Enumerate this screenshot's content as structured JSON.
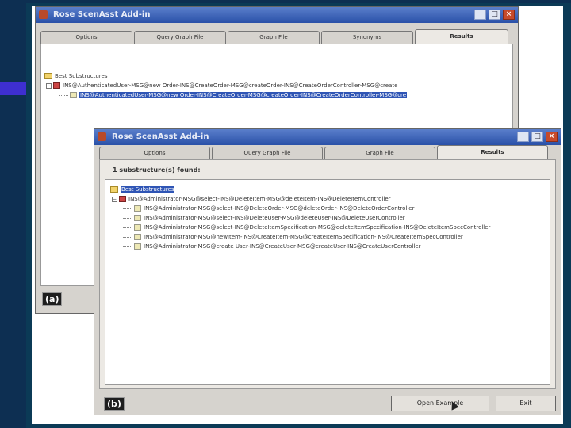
{
  "window_a": {
    "title": "Rose ScenAsst Add-in",
    "tabs": [
      "Options",
      "Query Graph File",
      "Graph File",
      "Synonyms",
      "Results"
    ],
    "tree": {
      "root": "Best Substructures",
      "node": "INS@AuthenticatedUser-MSG@new Order-INS@CreateOrder-MSG@createOrder-INS@CreateOrderController-MSG@create",
      "selected_leaf": "INS@AuthenticatedUser-MSG@new Order-INS@CreateOrder-MSG@createOrder-INS@CreateOrderController-MSG@cre"
    },
    "label": "(a)"
  },
  "window_b": {
    "title": "Rose ScenAsst Add-in",
    "tabs": [
      "Options",
      "Query Graph File",
      "Graph File",
      "Results"
    ],
    "found_text": "1 substructure(s) found:",
    "tree": {
      "root": "Best Substructures",
      "node": "INS@Administrator-MSG@select-INS@DeleteItem-MSG@deleteItem-INS@DeleteItemController",
      "leaves": [
        "INS@Administrator-MSG@select-INS@DeleteOrder-MSG@deleteOrder-INS@DeleteOrderController",
        "INS@Administrator-MSG@select-INS@DeleteUser-MSG@deleteUser-INS@DeleteUserController",
        "INS@Administrator-MSG@select-INS@DeleteItemSpecification-MSG@deleteItemSpecification-INS@DeleteItemSpecController",
        "INS@Administrator-MSG@newItem-INS@CreateItem-MSG@createItemSpecification-INS@CreateItemSpecController",
        "INS@Administrator-MSG@create User-INS@CreateUser-MSG@createUser-INS@CreateUserController"
      ]
    },
    "label": "(b)",
    "buttons": {
      "open": "Open Example",
      "exit": "Exit"
    }
  },
  "colors": {
    "titlebar": "#2a51a8",
    "selection": "#2f55b5",
    "slide_bg": "#0d2f52"
  }
}
